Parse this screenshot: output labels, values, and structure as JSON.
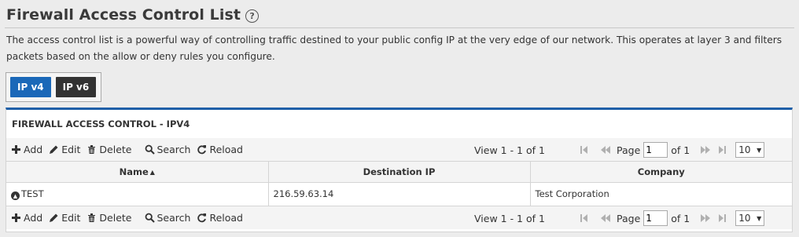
{
  "header": {
    "title": "Firewall Access Control List",
    "help_icon": "question-circle-icon",
    "description": "The access control list is a powerful way of controlling traffic destined to your public config IP at the very edge of our network. This operates at layer 3 and filters packets based on the allow or deny rules you configure."
  },
  "ip_tabs": [
    {
      "label": "IP v4",
      "active": true
    },
    {
      "label": "IP v6",
      "active": false
    }
  ],
  "panel": {
    "title": "FIREWALL ACCESS CONTROL - IPV4"
  },
  "toolbar": {
    "add_label": "Add",
    "edit_label": "Edit",
    "delete_label": "Delete",
    "search_label": "Search",
    "reload_label": "Reload",
    "view_text": "View 1 - 1 of 1",
    "page_label": "Page",
    "page_value": "1",
    "of_label": "of 1",
    "rows_per_page": "10"
  },
  "table": {
    "columns": [
      "Name",
      "Destination IP",
      "Company"
    ],
    "rows": [
      {
        "name": "TEST",
        "destination_ip": "216.59.63.14",
        "company": "Test Corporation"
      }
    ]
  },
  "colors": {
    "accent": "#1a68b8",
    "panel_border": "#1f5fa8",
    "dark_button": "#333333"
  }
}
